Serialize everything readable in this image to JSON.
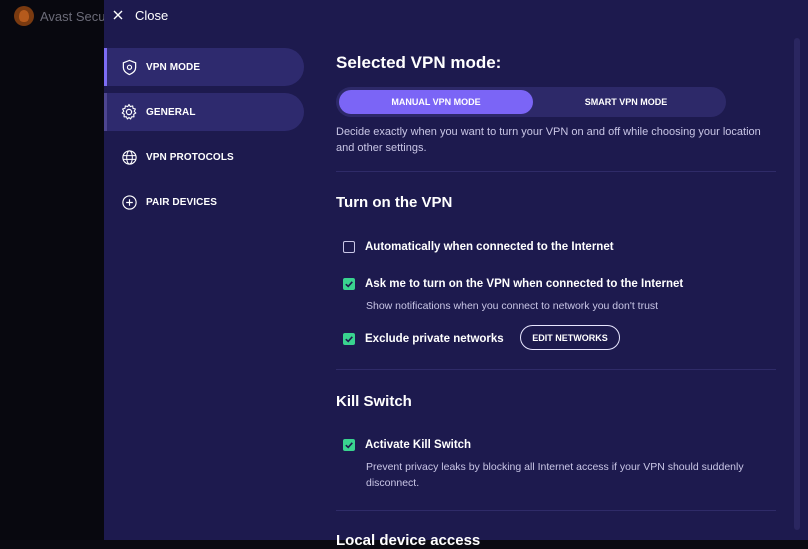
{
  "background_app": {
    "title": "Avast Secu"
  },
  "header": {
    "close_label": "Close"
  },
  "sidebar": {
    "items": [
      {
        "label": "VPN MODE",
        "icon": "shield-gear-icon",
        "active": true
      },
      {
        "label": "GENERAL",
        "icon": "gear-icon"
      },
      {
        "label": "VPN PROTOCOLS",
        "icon": "globe-icon"
      },
      {
        "label": "PAIR DEVICES",
        "icon": "plus-circle-icon"
      }
    ]
  },
  "main": {
    "mode_title": "Selected VPN mode:",
    "mode_options": {
      "manual": "MANUAL VPN MODE",
      "smart": "SMART VPN MODE",
      "selected": "manual"
    },
    "mode_description": "Decide exactly when you want to turn your VPN on and off while choosing your location and other settings.",
    "turn_on": {
      "title": "Turn on the VPN",
      "options": [
        {
          "label": "Automatically when connected to the Internet",
          "checked": false
        },
        {
          "label": "Ask me to turn on the VPN when connected to the Internet",
          "checked": true,
          "sub": "Show notifications when you connect to network you don't trust"
        },
        {
          "label": "Exclude private networks",
          "checked": true,
          "button": "EDIT NETWORKS"
        }
      ]
    },
    "kill_switch": {
      "title": "Kill Switch",
      "option": {
        "label": "Activate Kill Switch",
        "checked": true
      },
      "sub": "Prevent privacy leaks by blocking all Internet access if your VPN should suddenly disconnect."
    },
    "local_access": {
      "title": "Local device access"
    }
  },
  "colors": {
    "panel": "#1d1a4e",
    "accent": "#7b65f6",
    "check": "#39d38f"
  }
}
